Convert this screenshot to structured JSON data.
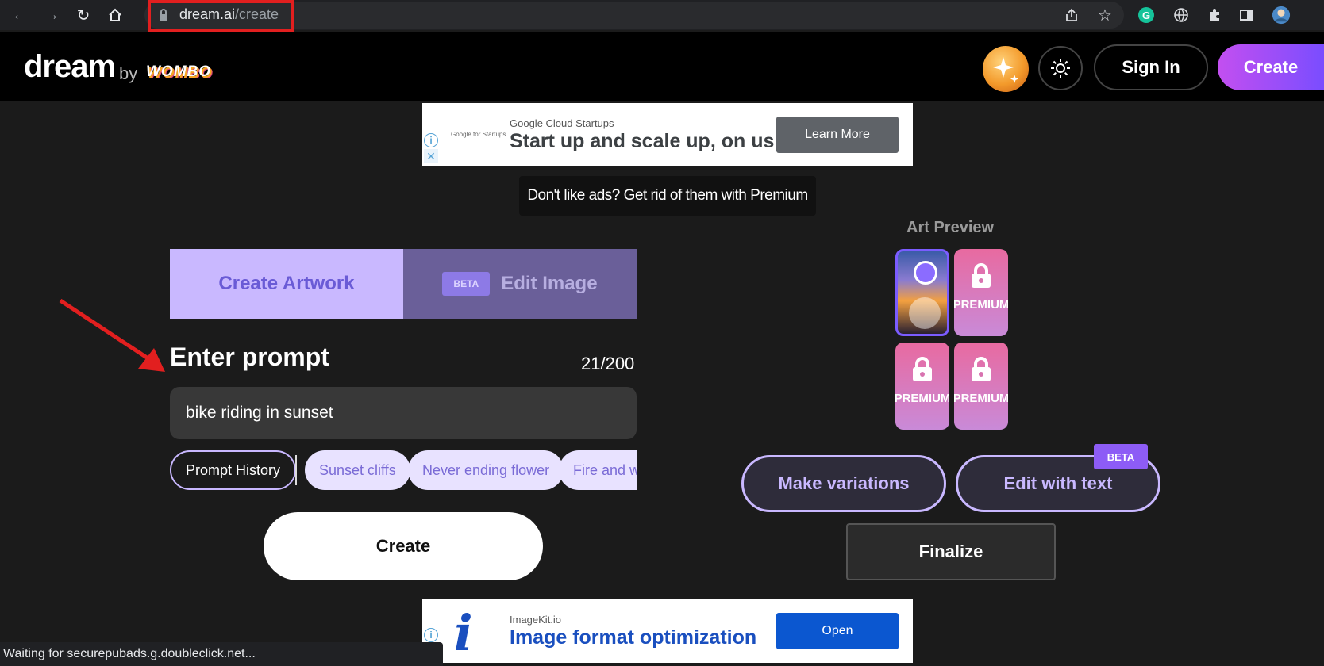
{
  "browser": {
    "url_host": "dream.ai",
    "url_path": "/create",
    "status_text": "Waiting for securepubads.g.doubleclick.net..."
  },
  "header": {
    "logo": "dream",
    "by": "by",
    "brand": "WOMBO",
    "sign_in_label": "Sign In",
    "create_label": "Create"
  },
  "ad_top": {
    "small": "Google for Startups",
    "brand": "Google Cloud Startups",
    "headline": "Start up and scale up, on us",
    "button": "Learn More"
  },
  "premium_link": "Don't like ads? Get rid of them with Premium",
  "tabs": {
    "create": "Create Artwork",
    "beta": "BETA",
    "edit": "Edit Image"
  },
  "prompt": {
    "title": "Enter prompt",
    "counter": "21/200",
    "value": "bike riding in sunset"
  },
  "chips": {
    "history": "Prompt History",
    "suggestions": [
      "Sunset cliffs",
      "Never ending flower",
      "Fire and water"
    ]
  },
  "create_button": "Create",
  "preview": {
    "title": "Art Preview",
    "premium_label": "PREMIUM"
  },
  "actions": {
    "variations": "Make variations",
    "edit_text": "Edit with text",
    "beta": "BETA",
    "finalize": "Finalize"
  },
  "ad_bottom": {
    "brand": "ImageKit.io",
    "headline": "Image format optimization",
    "button": "Open"
  },
  "colors": {
    "accent_purple": "#c9b8ff",
    "create_gradient_start": "#c34ff0",
    "create_gradient_end": "#7a4dff",
    "highlight_red": "#e21f1f"
  }
}
